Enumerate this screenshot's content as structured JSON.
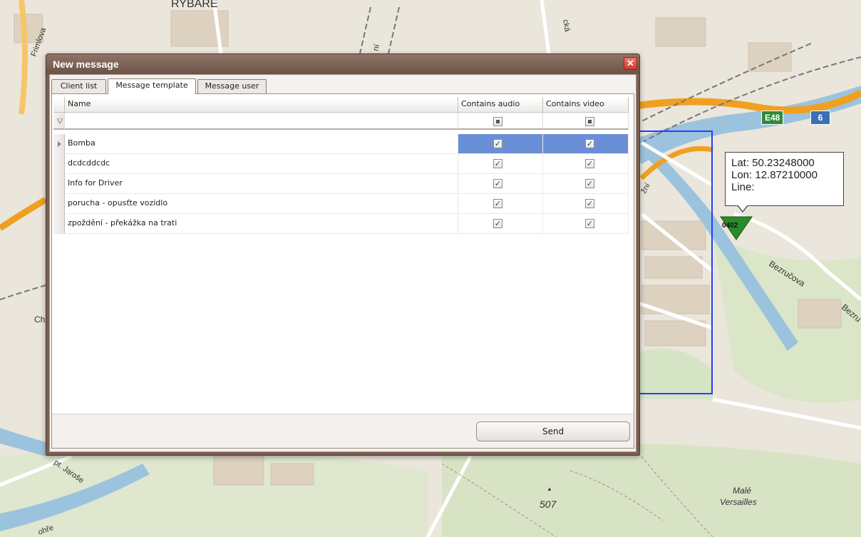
{
  "dialog": {
    "title": "New message",
    "tabs": [
      {
        "label": "Client list"
      },
      {
        "label": "Message template"
      },
      {
        "label": "Message user"
      }
    ],
    "active_tab": "Message template",
    "grid": {
      "columns": [
        "Name",
        "Contains audio",
        "Contains video"
      ],
      "sort": {
        "column": "Name",
        "direction": "ascending"
      },
      "rows": [
        {
          "name": "Bomba",
          "audio": true,
          "video": true,
          "selected": true
        },
        {
          "name": "dcdcddcdc",
          "audio": true,
          "video": true,
          "selected": false
        },
        {
          "name": "Info for Driver",
          "audio": true,
          "video": true,
          "selected": false
        },
        {
          "name": "porucha - opusťte vozidlo",
          "audio": true,
          "video": true,
          "selected": false
        },
        {
          "name": "zpoždění - překážka na trati",
          "audio": true,
          "video": true,
          "selected": false
        }
      ]
    },
    "send_label": "Send",
    "close_icon": "close-icon"
  },
  "map": {
    "labels": {
      "street_1": "Frimlova",
      "street_2": "Bezručova",
      "street_3": "Bezru",
      "street_4": "pt. Jaroše",
      "place": "Malé Versailles",
      "place_line1": "Malé",
      "place_line2": "Versailles",
      "elevation": "507",
      "partial_top": "RYBÁŘE",
      "partial_left": "Ch",
      "partial_ni": "ní",
      "partial_cka": "cká",
      "partial_zni": "žní",
      "partial_bottom": "ohře"
    },
    "road_shields": [
      {
        "label": "E48",
        "color": "#2f8a3c"
      },
      {
        "label": "6",
        "color": "#3b6fb6"
      }
    ],
    "tooltip": {
      "lat": "Lat: 50.23248000",
      "lon": "Lon: 12.87210000",
      "line": "Line:"
    },
    "vehicle_label": "0402",
    "colors": {
      "water": "#9cc3dd",
      "highway": "#f0a020",
      "selection_box": "#2040ff",
      "vehicle": "#2b8a2b"
    }
  }
}
